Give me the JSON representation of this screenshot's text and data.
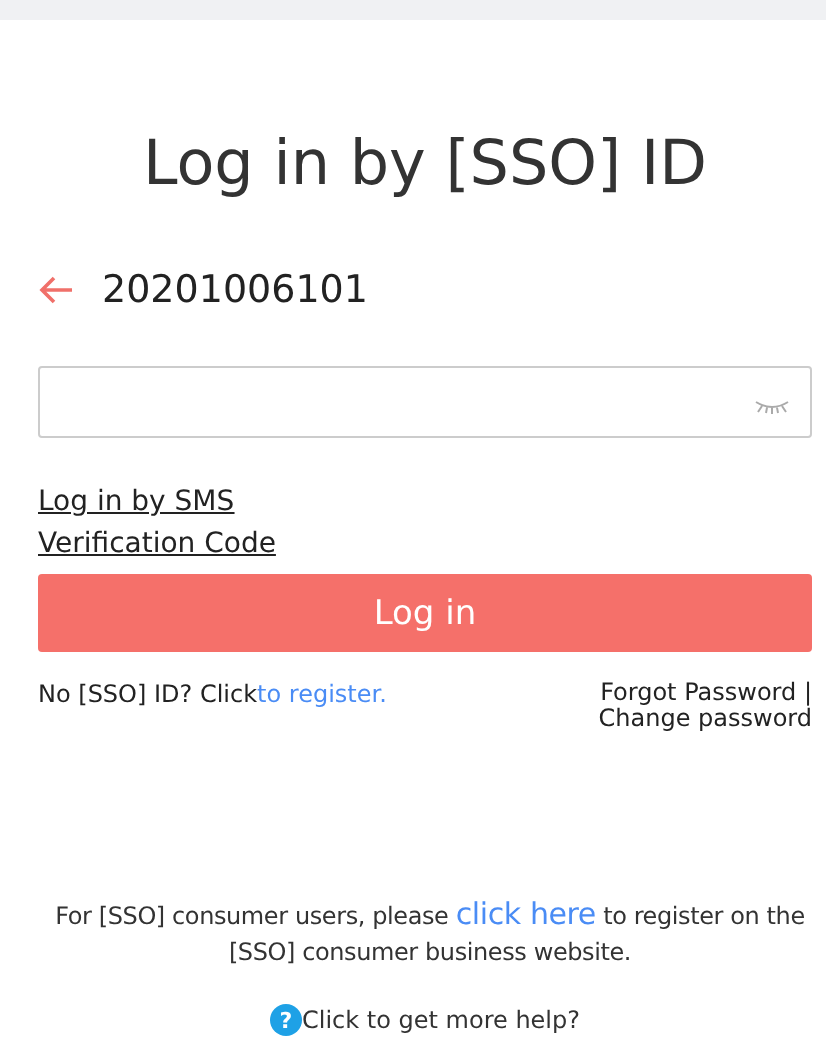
{
  "title": "Log in by [SSO] ID",
  "account": {
    "id": "20201006101"
  },
  "password_field": {
    "visible": false
  },
  "sms_link": {
    "line1": "Log in by SMS",
    "line2": "Verification Code"
  },
  "login_button": {
    "label": "Log in"
  },
  "register": {
    "text": "No [SSO] ID? Click",
    "link": "to register."
  },
  "password_links": [
    "Forgot Password |",
    "Change password"
  ],
  "consumer_note": {
    "before": "For [SSO] consumer users, please ",
    "link": "click here",
    "after": " to register on the [SSO] consumer business website."
  },
  "help": {
    "icon": "?",
    "text": "Click to get more help?"
  }
}
